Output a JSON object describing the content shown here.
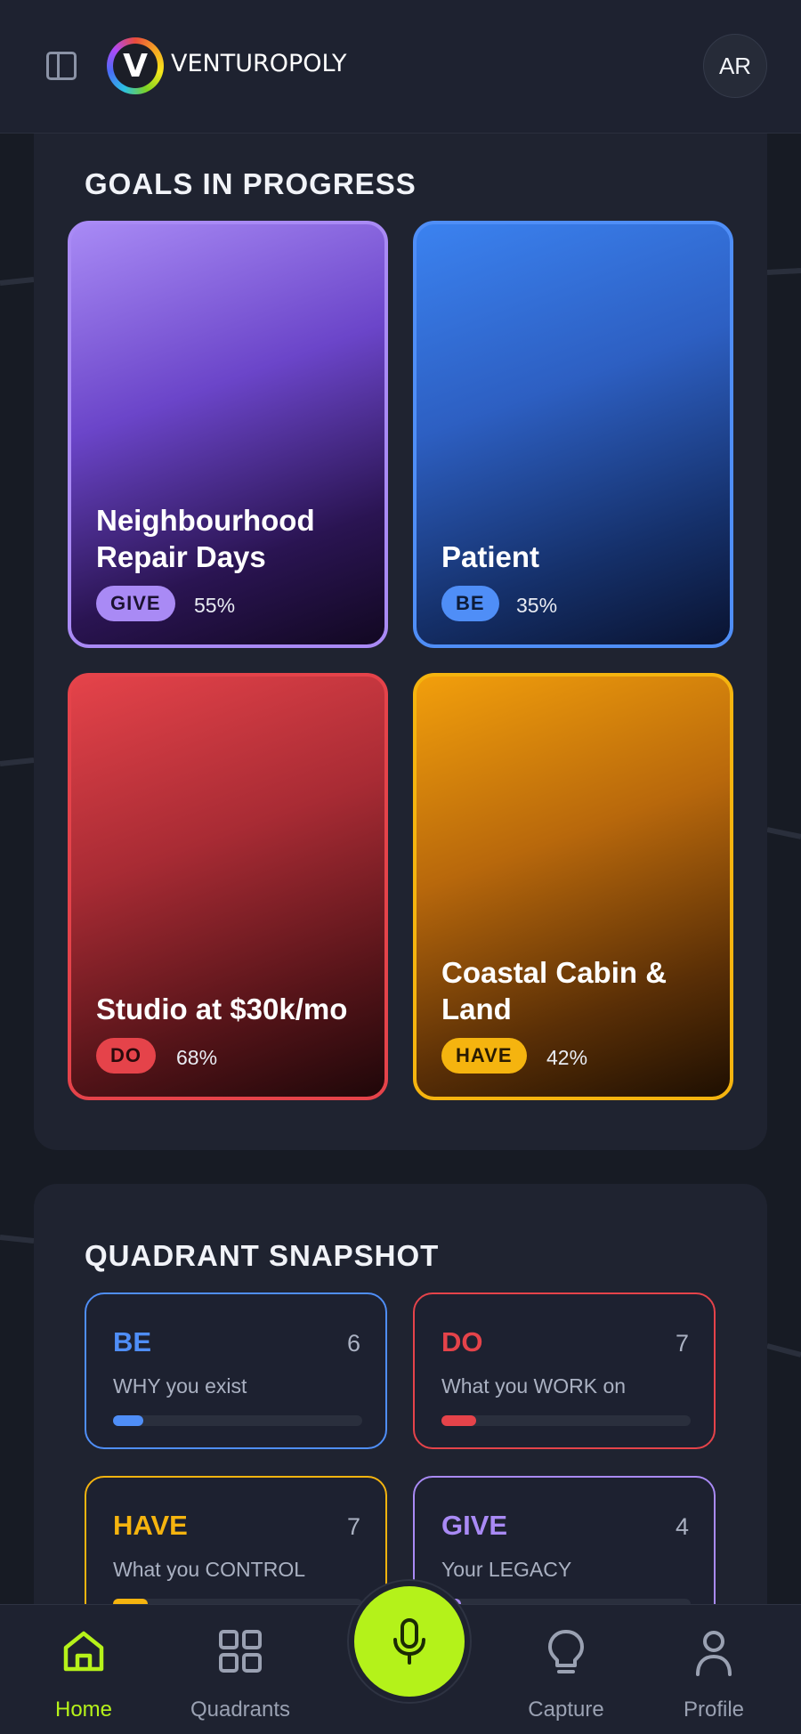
{
  "header": {
    "logo_letter": "V",
    "brand": "VENTUROPOLY",
    "avatar_initials": "AR"
  },
  "goals": {
    "title": "GOALS IN PROGRESS",
    "cards": [
      {
        "title_lines": [
          "Neighbourhood",
          "Repair Days"
        ],
        "badge": "GIVE",
        "percent": "55%",
        "color": "#a98af5"
      },
      {
        "title_lines": [
          "Patient"
        ],
        "badge": "BE",
        "percent": "35%",
        "color": "#4f8ef7"
      },
      {
        "title_lines": [
          "Studio at $30k/mo"
        ],
        "badge": "DO",
        "percent": "68%",
        "color": "#e5434a"
      },
      {
        "title_lines": [
          "Coastal Cabin &",
          "Land"
        ],
        "badge": "HAVE",
        "percent": "42%",
        "color": "#f5b40f"
      }
    ]
  },
  "quadrants": {
    "title": "QUADRANT SNAPSHOT",
    "cards": [
      {
        "name": "BE",
        "count": "6",
        "description": "WHY you exist",
        "progress": 0.12,
        "color": "#4f8ef7"
      },
      {
        "name": "DO",
        "count": "7",
        "description": "What you WORK on",
        "progress": 0.14,
        "color": "#e5434a"
      },
      {
        "name": "HAVE",
        "count": "7",
        "description": "What you CONTROL",
        "progress": 0.14,
        "color": "#f5b40f"
      },
      {
        "name": "GIVE",
        "count": "4",
        "description": "Your LEGACY",
        "progress": 0.08,
        "color": "#a98af5"
      }
    ]
  },
  "nav": {
    "home": "Home",
    "quadrants": "Quadrants",
    "capture": "Capture",
    "profile": "Profile",
    "active_color": "#b6f21a",
    "mic_color": "#b4f21a"
  }
}
